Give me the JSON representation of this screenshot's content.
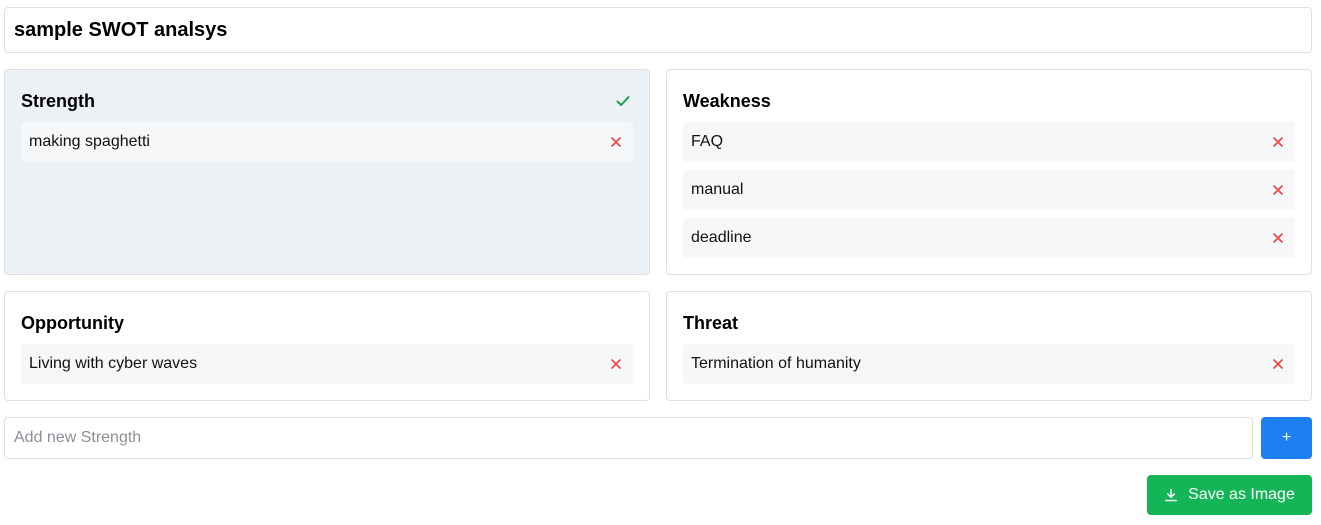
{
  "title": "sample SWOT analsys",
  "quadrants": {
    "strength": {
      "title": "Strength",
      "selected": true,
      "items": [
        "making spaghetti"
      ]
    },
    "weakness": {
      "title": "Weakness",
      "items": [
        "FAQ",
        "manual",
        "deadline"
      ]
    },
    "opportunity": {
      "title": "Opportunity",
      "items": [
        "Living with cyber waves"
      ]
    },
    "threat": {
      "title": "Threat",
      "items": [
        "Termination of humanity"
      ]
    }
  },
  "add": {
    "value": "",
    "placeholder": "Add new Strength",
    "button_label": "+"
  },
  "save_button_label": "Save as Image",
  "icons": {
    "selected": "check-icon",
    "remove": "close-icon",
    "save": "download-icon"
  },
  "colors": {
    "selected_quadrant": "#ecf1f6",
    "check": "#17a34a",
    "remove": "#ef4444",
    "add_button": "#1e7ff0",
    "save_button": "#13b556"
  }
}
